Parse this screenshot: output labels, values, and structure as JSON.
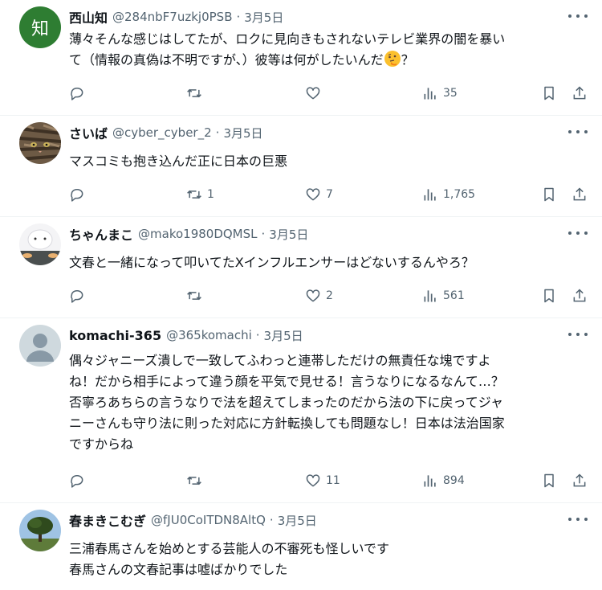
{
  "colors": {
    "text": "#0f1419",
    "muted": "#536471",
    "divider": "#eff3f4",
    "avatar_kanji_bg": "#2e7d32"
  },
  "icons": [
    "reply-icon",
    "retweet-icon",
    "like-icon",
    "views-icon",
    "bookmark-icon",
    "share-icon",
    "more-icon",
    "thinking-face-emoji"
  ],
  "tweets": [
    {
      "name": "西山知",
      "handle": "@284nbF7uzkj0PSB",
      "sep": "·",
      "date": "3月5日",
      "avatar_text": "知",
      "lines": [
        "薄々そんな感じはしてたが、ロクに見向きもされないテレビ業界の闇を暴い",
        "て（情報の真偽は不明ですが、）彼等は何がしたいんだ",
        "？"
      ],
      "replies": "",
      "retweets": "",
      "likes": "",
      "views": "35"
    },
    {
      "name": "さいば",
      "handle": "@cyber_cyber_2",
      "sep": "·",
      "date": "3月5日",
      "lines": [
        "マスコミも抱き込んだ正に日本の巨悪"
      ],
      "replies": "",
      "retweets": "1",
      "likes": "7",
      "views": "1,765"
    },
    {
      "name": "ちゃんまこ",
      "handle": "@mako1980DQMSL",
      "sep": "·",
      "date": "3月5日",
      "lines": [
        "文春と一緒になって叩いてたXインフルエンサーはどないするんやろ？"
      ],
      "replies": "",
      "retweets": "",
      "likes": "2",
      "views": "561"
    },
    {
      "name": "komachi-365",
      "handle": "@365komachi",
      "sep": "·",
      "date": "3月5日",
      "lines": [
        "偶々ジャニーズ潰しで一致してふわっと連帯しただけの無責任な塊ですよ",
        "ね！だから相手によって違う顔を平気で見せる！言うなりになるなんて…？",
        "否寧ろあちらの言うなりで法を超えてしまったのだから法の下に戻ってジャ",
        "ニーさんも守り法に則った対応に方針転換しても問題なし！日本は法治国家",
        "ですからね"
      ],
      "replies": "",
      "retweets": "",
      "likes": "11",
      "views": "894"
    },
    {
      "name": "春まきこむぎ",
      "handle": "@fJU0CoITDN8AltQ",
      "sep": "·",
      "date": "3月5日",
      "lines": [
        "三浦春馬さんを始めとする芸能人の不審死も怪しいです",
        "春馬さんの文春記事は嘘ばかりでした"
      ]
    }
  ]
}
